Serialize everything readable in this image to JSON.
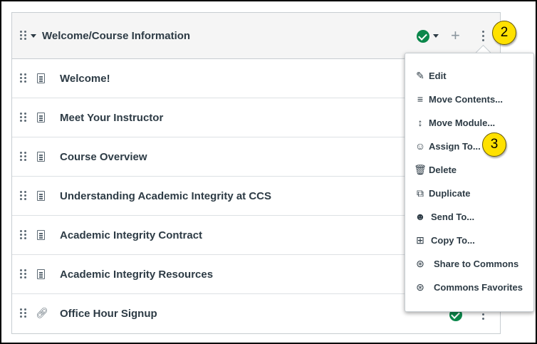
{
  "module": {
    "title": "Welcome/Course Information",
    "items": [
      {
        "title": "Welcome!",
        "icon": "page-icon"
      },
      {
        "title": "Meet Your Instructor",
        "icon": "page-icon"
      },
      {
        "title": "Course Overview",
        "icon": "page-icon"
      },
      {
        "title": "Understanding Academic Integrity at CCS",
        "icon": "page-icon"
      },
      {
        "title": "Academic Integrity Contract",
        "icon": "page-icon"
      },
      {
        "title": "Academic Integrity Resources",
        "icon": "page-icon"
      },
      {
        "title": "Office Hour Signup",
        "icon": "link-icon"
      }
    ]
  },
  "menu": {
    "items": [
      {
        "label": "Edit",
        "icon": "pencil-icon"
      },
      {
        "label": "Move Contents...",
        "icon": "move-contents-icon"
      },
      {
        "label": "Move Module...",
        "icon": "move-module-icon"
      },
      {
        "label": "Assign To...",
        "icon": "assign-icon"
      },
      {
        "label": "Delete",
        "icon": "trash-icon"
      },
      {
        "label": "Duplicate",
        "icon": "duplicate-icon"
      },
      {
        "label": "Send To...",
        "icon": "send-icon"
      },
      {
        "label": "Copy To...",
        "icon": "copy-icon"
      },
      {
        "label": "Share to Commons",
        "icon": "commons-icon"
      },
      {
        "label": "Commons Favorites",
        "icon": "commons-icon"
      }
    ]
  },
  "callouts": {
    "first": "2",
    "second": "3"
  },
  "colors": {
    "publish_green": "#0b874b",
    "callout_yellow": "#ffe100",
    "header_bg": "#f5f5f5"
  }
}
